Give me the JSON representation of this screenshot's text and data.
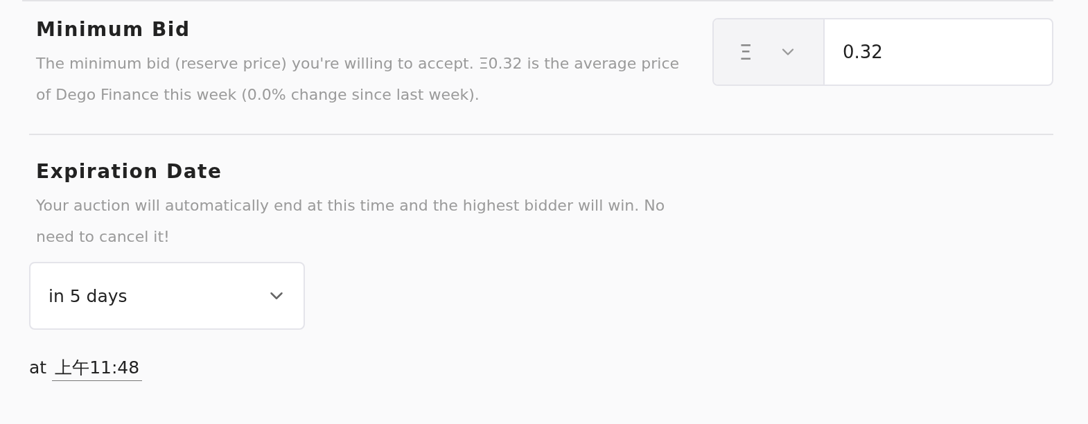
{
  "sections": [
    {
      "kind": "price",
      "title": "Minimum Bid",
      "description": "The minimum bid (reserve price) you're willing to accept. Ξ0.32 is the average price of Dego Finance this week (0.0% change since last week).",
      "currency_symbol": "Ξ",
      "value": "0.32"
    },
    {
      "kind": "date",
      "title": "Expiration Date",
      "description": "Your auction will automatically end at this time and the highest bidder will win. No need to cancel it!",
      "duration": "in 5 days",
      "time_prefix": "at",
      "time": "上午11:48"
    }
  ]
}
